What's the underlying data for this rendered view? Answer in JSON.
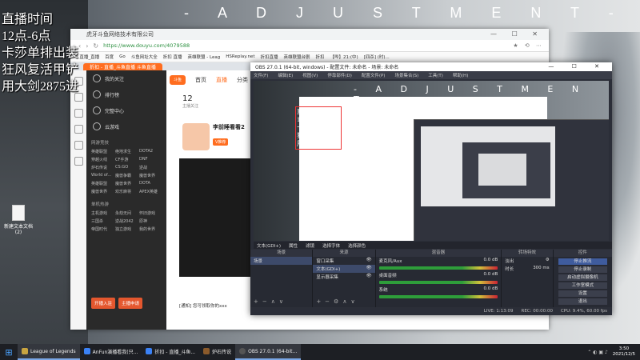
{
  "desktop": {
    "watermark": "- A D J U S T M E N T -",
    "overlay_lines": [
      "直播时间",
      "12点-6点",
      "卡莎单排出装",
      "狂风复活甲铲",
      "用大剑2875进"
    ],
    "icon_label": "新建文本文档(2)"
  },
  "browser": {
    "url": "https://www.douyu.com/4079588",
    "url_prefix": "虎牙斗鱼网络技术有限公司",
    "tab_title": "折扣 - 直播_斗鱼直播 斗鱼直播",
    "bookmarks": [
      "A/ 直播_直播",
      "百度",
      "Go",
      "斗鱼网址大全",
      "折扣 直播",
      "英雄联盟 - Leag",
      "HSReplay.net",
      "折扣直播",
      "英雄联盟台剧",
      "折扣",
      "【哔】21:(中)",
      "[四杀]  (时)..."
    ],
    "nav": [
      "首页",
      "直播",
      "分类",
      "排行"
    ],
    "stats_value": "12",
    "stats_label": "主播关注",
    "sidebar": {
      "items": [
        "我的关注",
        "排行榜",
        "完整中心",
        "云游戏"
      ],
      "section1": "网游竞技",
      "games1": [
        "英雄联盟",
        "绝地求生",
        "DOTA2",
        "穿越火线",
        "CF手游",
        "DNF",
        "炉石传说",
        "CS:GO",
        "逆战",
        "World of...",
        "魔兽争霸",
        "魔兽世界",
        "英雄联盟",
        "魔兽世界",
        "DOTA",
        "魔兽世界",
        "欢乐麻将",
        "APEX英雄"
      ],
      "section2": "单机热游",
      "games2": [
        "主机游戏",
        "永劫无间",
        "怀旧游戏",
        "三国杀",
        "逆战2042",
        "原神",
        "帝国时代",
        "独立游戏",
        "我的世界"
      ],
      "btn_left": "开播入驻",
      "btn_right": "主播申请"
    },
    "streamer": {
      "name": "李前睡看看2",
      "tag": "V推荐"
    },
    "bottom_text": "[通知] 您可领取你的xxx"
  },
  "obs": {
    "title": "OBS 27.0.1 (64-bit, windows) - 配置文件: 未命名 - 场景: 未命名",
    "menu": [
      "文件(F)",
      "编辑(E)",
      "视图(V)",
      "停靠部件(D)",
      "配置文件(P)",
      "场景集合(S)",
      "工具(T)",
      "帮助(H)"
    ],
    "status_row": [
      "文本(GDI+)",
      "属性",
      "滤镜",
      "选择字体",
      "选择颜色"
    ],
    "docks": {
      "scenes": {
        "title": "场景",
        "items": [
          "场景"
        ]
      },
      "sources": {
        "title": "来源",
        "items": [
          "窗口采集",
          "文本(GDI+)",
          "显示器采集"
        ]
      },
      "mixer": {
        "title": "混音器",
        "channels": [
          {
            "name": "麦克风/Aux",
            "level": "0.0 dB"
          },
          {
            "name": "桌面音频",
            "level": "0.0 dB"
          },
          {
            "name": "系统",
            "level": "0.0 dB"
          }
        ]
      },
      "transitions": {
        "title": "转场特效",
        "type": "淡出",
        "duration_label": "时长",
        "duration": "300 ms"
      },
      "controls": {
        "title": "控件",
        "buttons": [
          "停止推流",
          "停止录制",
          "启动虚拟摄像机",
          "工作室模式",
          "设置",
          "退出"
        ]
      }
    },
    "footer": [
      "LIVE: 1:13:09",
      "REC: 00:00:00",
      "CPU: 9.4%, 60.00 fps"
    ]
  },
  "taskbar": {
    "items": [
      {
        "label": "League of Legends",
        "color": "#c8a440"
      },
      {
        "label": "AnFun演播看我(只...",
        "color": "#3b82f6"
      },
      {
        "label": "折扣 - 直播_斗鱼...",
        "color": "#3b82f6"
      },
      {
        "label": "炉石传说",
        "color": "#8b5a2b"
      },
      {
        "label": "OBS 27.0.1 (64-bit...",
        "color": "#444"
      }
    ],
    "time": "3:50",
    "date": "2021/12/5"
  }
}
